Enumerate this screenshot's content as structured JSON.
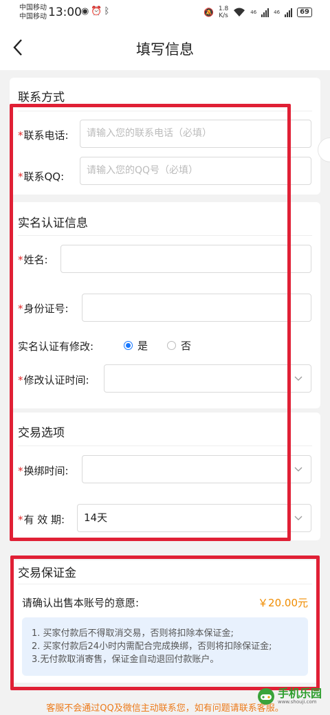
{
  "status_bar": {
    "carrier1": "中国移动",
    "carrier2": "中国移动",
    "time": "13:00",
    "net_speed_value": "1.8",
    "net_speed_unit": "K/s",
    "signal1_label": "46",
    "signal2_label": "46",
    "battery": "69"
  },
  "header": {
    "title": "填写信息",
    "back_icon": "chevron-left-icon"
  },
  "contact": {
    "title": "联系方式",
    "required_mark": "*",
    "phone_label": "联系电话:",
    "phone_placeholder": "请输入您的联系电话（必填）",
    "qq_label": "联系QQ:",
    "qq_placeholder": "请输入您的QQ号（必填）"
  },
  "realname": {
    "title": "实名认证信息",
    "name_label": "姓名:",
    "name_value": "",
    "id_label": "身份证号:",
    "id_value": "",
    "modified_label": "实名认证有修改:",
    "option_yes": "是",
    "option_no": "否",
    "selected": "是",
    "modify_time_label": "修改认证时间:",
    "modify_time_value": ""
  },
  "trade": {
    "title": "交易选项",
    "rebind_label": "换绑时间:",
    "rebind_value": "",
    "validity_label": "有 效 期:",
    "validity_value": "14天"
  },
  "deposit": {
    "title": "交易保证金",
    "confirm_text": "请确认出售本账号的意愿:",
    "amount": "￥20.00元",
    "notes": [
      "1. 买家付款后不得取消交易，否则将扣除本保证金;",
      "2. 买家付款后24小时内需配合完成换绑，否则将扣除保证金;",
      "3.无付款取消寄售，保证金自动退回付款账户。"
    ]
  },
  "footer_notice": "客服不会通过QQ及微信主动联系您，如有问题请联系客服。",
  "watermark": {
    "name": "手机乐园",
    "url": "www.shouji.com"
  },
  "colors": {
    "required": "#e02424",
    "highlight_box": "#e02035",
    "price": "#f08c00",
    "notice": "#ec7a1a",
    "radio_active": "#1677ff",
    "notes_bg": "#e8f1fd"
  }
}
